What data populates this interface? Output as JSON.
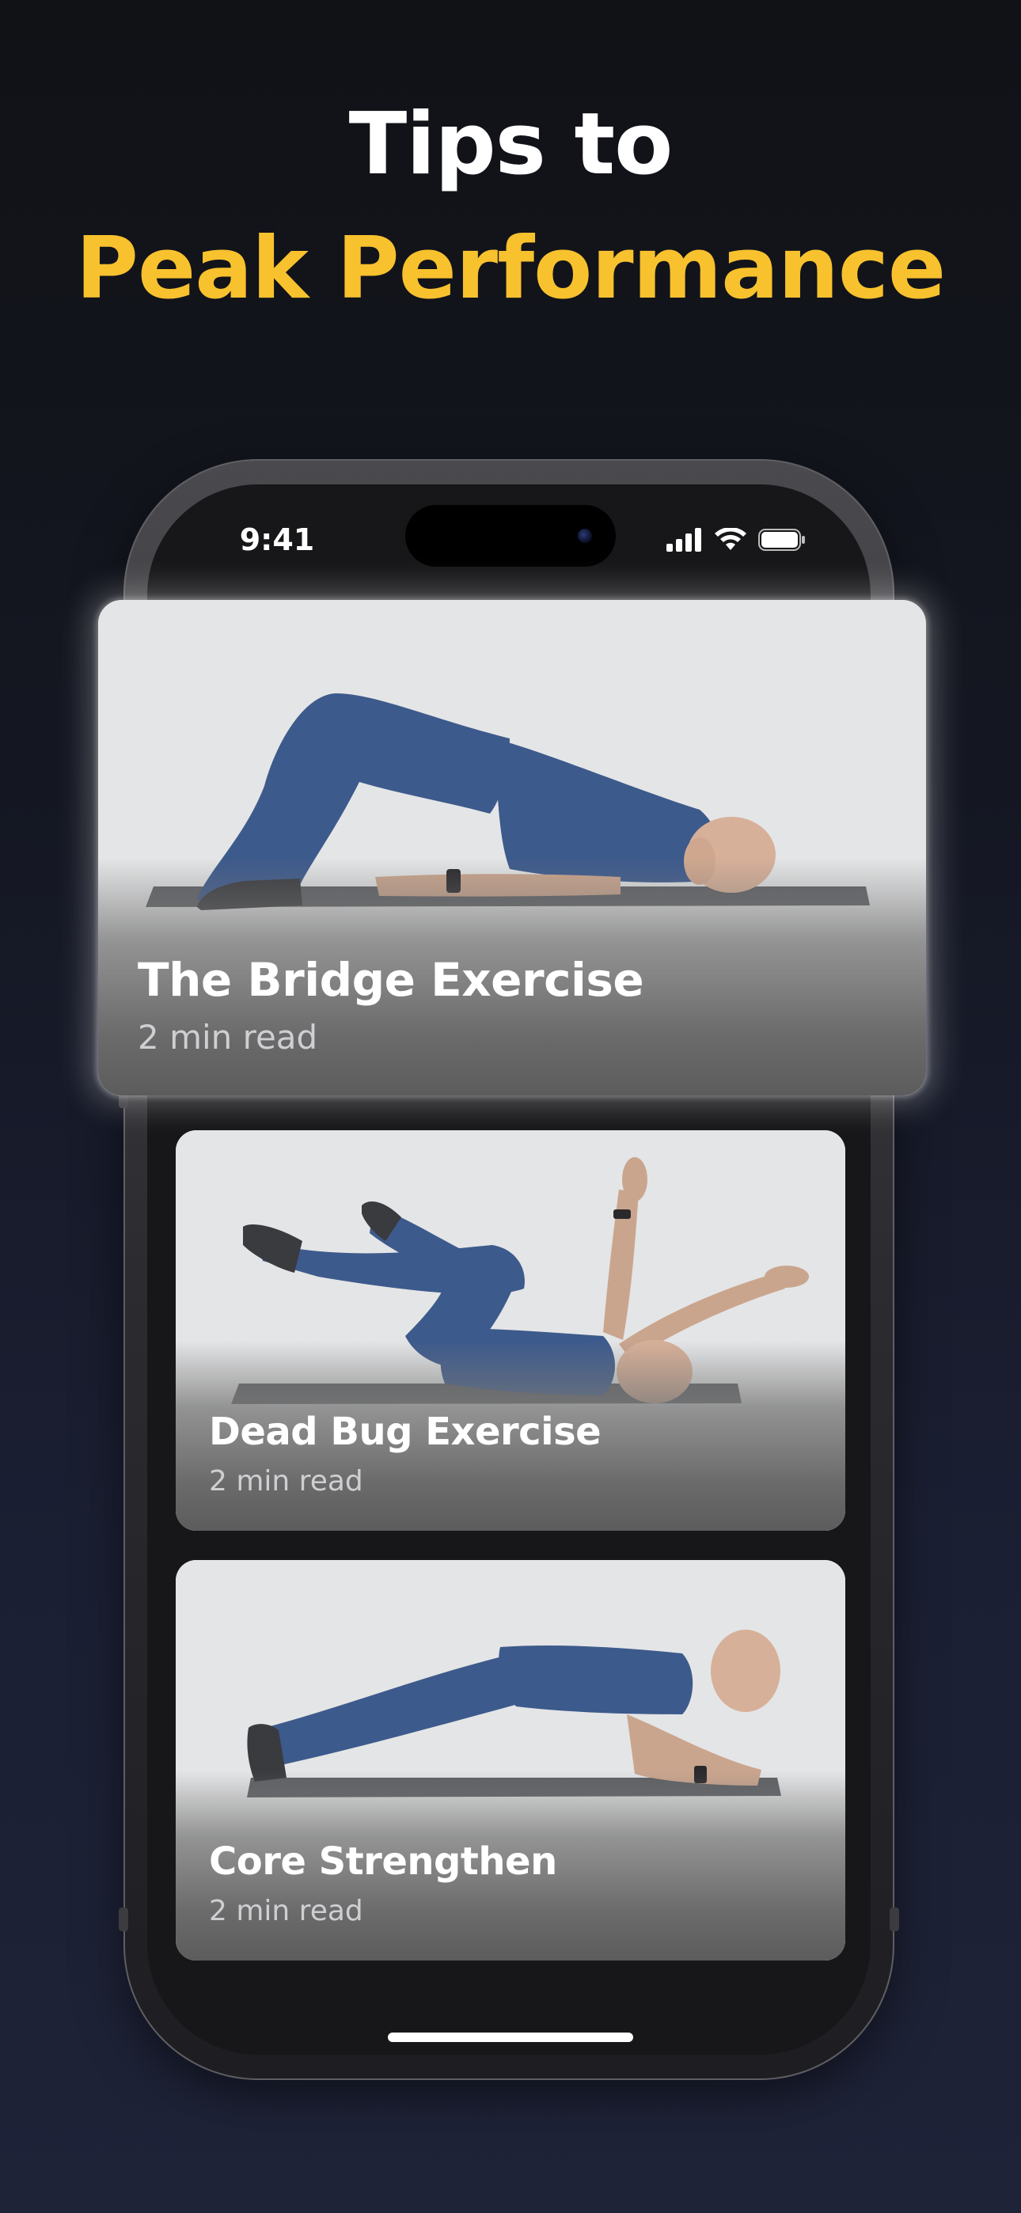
{
  "headline": {
    "line1": "Tips to",
    "line2": "Peak Performance",
    "accent_color": "#f8c12e"
  },
  "status_bar": {
    "time": "9:41",
    "icons": [
      "signal-icon",
      "wifi-icon",
      "battery-icon"
    ]
  },
  "articles": [
    {
      "title": "The Bridge Exercise",
      "subtitle": "2 min read"
    },
    {
      "title": "Dead Bug Exercise",
      "subtitle": "2 min read"
    },
    {
      "title": "Core Strengthen",
      "subtitle": "2 min read"
    }
  ]
}
